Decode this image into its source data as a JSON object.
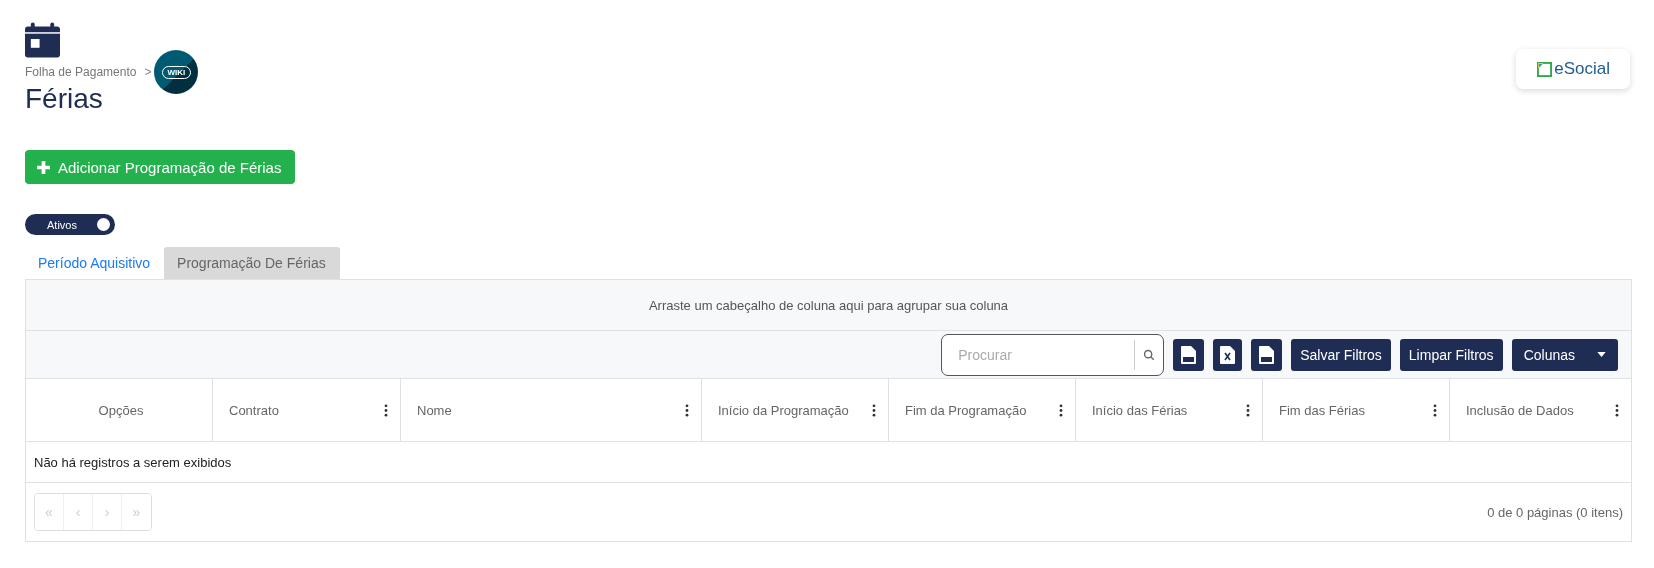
{
  "breadcrumb": {
    "parent": "Folha de Pagamento",
    "separator": ">",
    "wiki": "WIKI"
  },
  "title": "Férias",
  "brand": {
    "name": "eSocial"
  },
  "add_button": {
    "label": "Adicionar Programação de Férias"
  },
  "toggle": {
    "label": "Ativos",
    "on": true
  },
  "tabs": [
    {
      "label": "Período Aquisitivo",
      "selected": false
    },
    {
      "label": "Programação De Férias",
      "selected": true
    }
  ],
  "grid": {
    "group_hint": "Arraste um cabeçalho de coluna aqui para agrupar sua coluna",
    "search": {
      "placeholder": "Procurar"
    },
    "toolbar": [
      {
        "kind": "pdf"
      },
      {
        "kind": "xls"
      },
      {
        "kind": "csv"
      },
      {
        "kind": "button",
        "label": "Salvar Filtros"
      },
      {
        "kind": "button",
        "label": "Limpar Filtros"
      },
      {
        "kind": "dropdown",
        "label": "Colunas"
      }
    ],
    "columns": [
      {
        "label": "Opções",
        "menu": false
      },
      {
        "label": "Contrato",
        "menu": true
      },
      {
        "label": "Nome",
        "menu": true
      },
      {
        "label": "Início da Programação",
        "menu": true
      },
      {
        "label": "Fim da Programação",
        "menu": true
      },
      {
        "label": "Início das Férias",
        "menu": true
      },
      {
        "label": "Fim das Férias",
        "menu": true
      },
      {
        "label": "Inclusão de Dados",
        "menu": true
      }
    ],
    "empty_message": "Não há registros a serem exibidos",
    "pager": [
      {
        "label": "«",
        "disabled": true
      },
      {
        "label": "‹",
        "disabled": true
      },
      {
        "label": "›",
        "disabled": true
      },
      {
        "label": "»",
        "disabled": true
      }
    ],
    "page_info": "0 de 0 páginas (0 itens)"
  }
}
